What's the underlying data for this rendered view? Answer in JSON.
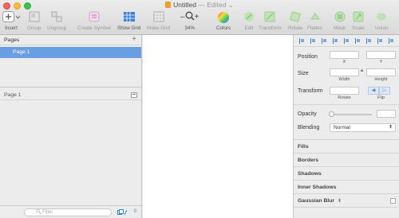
{
  "window": {
    "title": "Untitled",
    "status": "— Edited",
    "status_chevron": "⌄"
  },
  "toolbar": {
    "items": [
      {
        "label": "Insert",
        "icon": "plus-icon"
      },
      {
        "label": "Group",
        "icon": "group-icon"
      },
      {
        "label": "Ungroup",
        "icon": "ungroup-icon"
      },
      {
        "label": "Create Symbol",
        "icon": "create-symbol-icon"
      },
      {
        "label": "Show Grid",
        "icon": "grid-icon"
      },
      {
        "label": "Make Grid",
        "icon": "make-grid-icon"
      },
      {
        "label": "34%",
        "icon": "zoom-icon"
      },
      {
        "label": "Colors",
        "icon": "color-wheel-icon"
      },
      {
        "label": "Edit",
        "icon": "edit-icon"
      },
      {
        "label": "Transform",
        "icon": "transform-icon"
      },
      {
        "label": "Rotate",
        "icon": "rotate-icon"
      },
      {
        "label": "Flatten",
        "icon": "flatten-icon"
      },
      {
        "label": "Mask",
        "icon": "mask-icon"
      },
      {
        "label": "Scale",
        "icon": "scale-icon"
      },
      {
        "label": "Union",
        "icon": "union-icon"
      }
    ],
    "zoom_minus": "–",
    "zoom_plus": "+"
  },
  "pages": {
    "header": "Pages",
    "add": "+",
    "items": [
      "Page 1"
    ]
  },
  "layers": {
    "header": "Page 1"
  },
  "footer": {
    "filter_placeholder": "Filter",
    "count": "0"
  },
  "inspector": {
    "position_label": "Position",
    "x_label": "X",
    "y_label": "Y",
    "size_label": "Size",
    "width_label": "Width",
    "height_label": "Height",
    "transform_label": "Transform",
    "rotate_label": "Rotate",
    "flip_label": "Flip",
    "opacity_label": "Opacity",
    "blending_label": "Blending",
    "blending_value": "Normal",
    "groups": [
      "Fills",
      "Borders",
      "Shadows",
      "Inner Shadows",
      "Gaussian Blur"
    ]
  },
  "colors": {
    "selection": "#699ee2",
    "accent": "#3a7fd8",
    "green_icon": "#7dc96b"
  }
}
